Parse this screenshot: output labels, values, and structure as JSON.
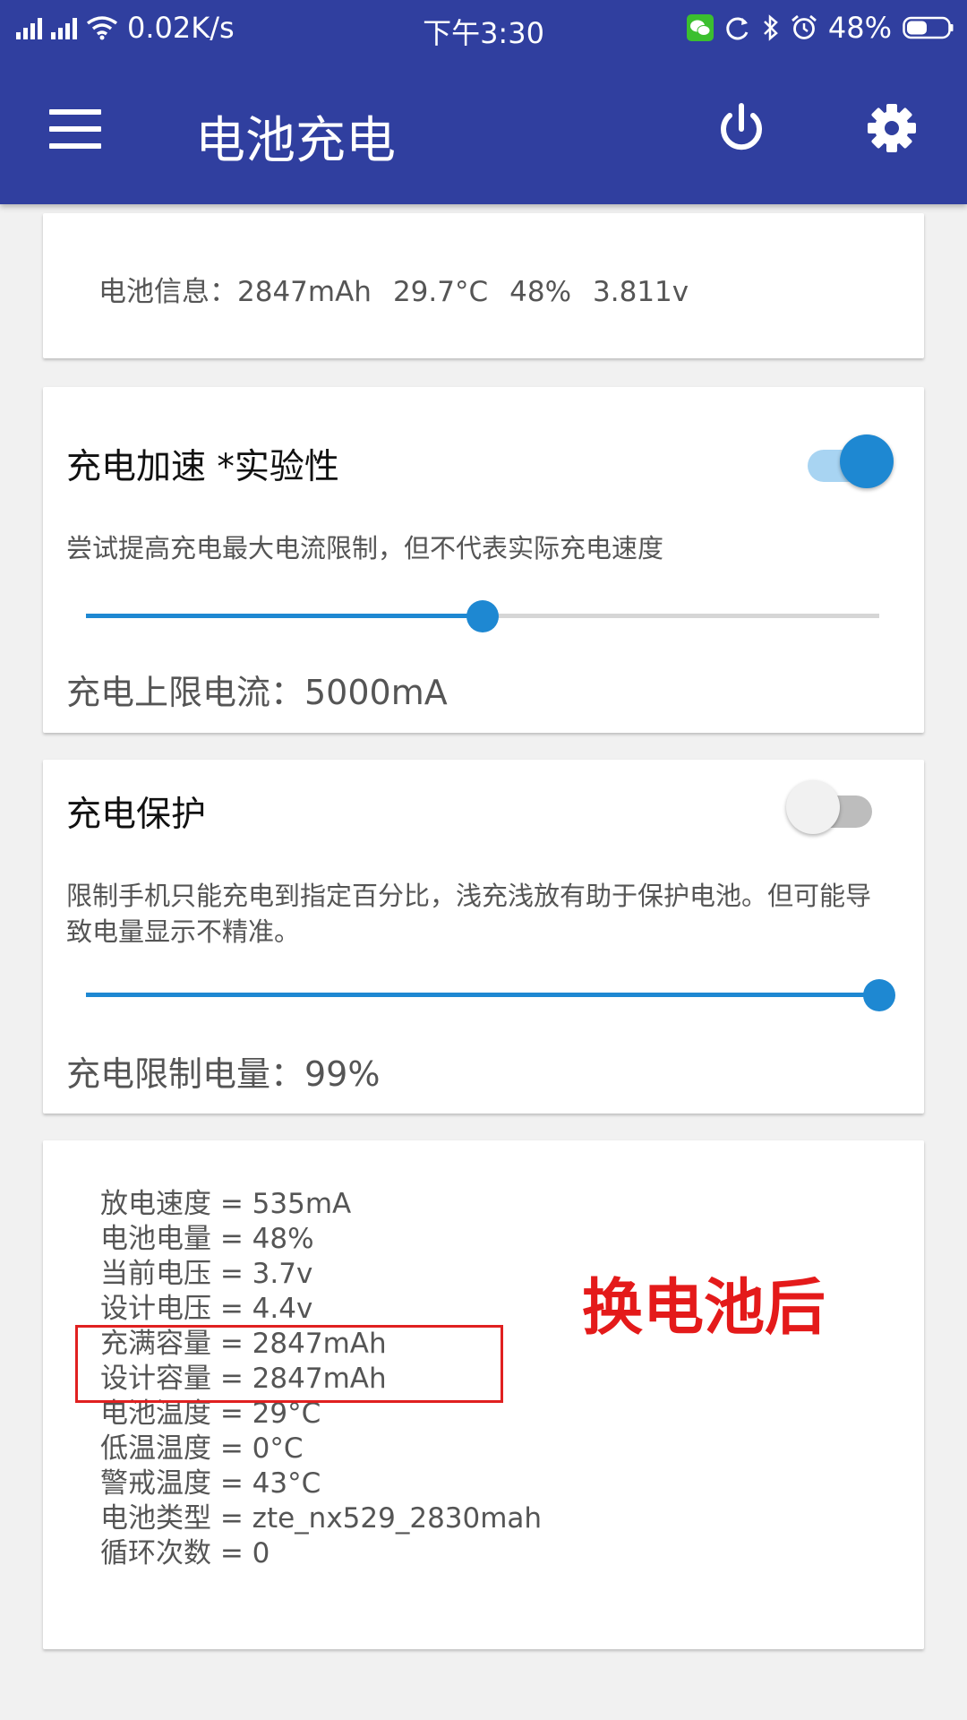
{
  "status_bar": {
    "net_speed": "0.02K/s",
    "time": "下午3:30",
    "battery": "48%",
    "icons": [
      "signal-icon",
      "signal-icon",
      "wifi-icon",
      "wechat-icon",
      "sync-icon",
      "bluetooth-icon",
      "alarm-icon",
      "battery-icon"
    ]
  },
  "toolbar": {
    "title": "电池充电",
    "menu_icon": "menu-icon",
    "power_icon": "power-icon",
    "settings_icon": "gear-icon"
  },
  "battery_info": {
    "label": "电池信息：",
    "capacity": "2847mAh",
    "temp": "29.7°C",
    "level": "48%",
    "voltage": "3.811v"
  },
  "boost": {
    "title": "充电加速 *实验性",
    "enabled": true,
    "desc": "尝试提高充电最大电流限制，但不代表实际充电速度",
    "slider_fraction": 0.5,
    "footer": "充电上限电流：5000mA"
  },
  "protect": {
    "title": "充电保护",
    "enabled": false,
    "desc": "限制手机只能充电到指定百分比，浅充浅放有助于保护电池。但可能导致电量显示不精准。",
    "slider_fraction": 1.0,
    "footer": "充电限制电量：99%"
  },
  "stats": [
    "放电速度 = 535mA",
    "电池电量 = 48%",
    "当前电压 = 3.7v",
    "设计电压 = 4.4v",
    "充满容量 = 2847mAh",
    "设计容量 = 2847mAh",
    "电池温度 = 29°C",
    "低温温度 = 0°C",
    "警戒温度 = 43°C",
    "电池类型 = zte_nx529_2830mah",
    "循环次数 = 0"
  ],
  "annotation": {
    "text": "换电池后",
    "color": "#e41a1a"
  },
  "colors": {
    "appbar": "#303f9f",
    "accent": "#1e88d2",
    "switch_on_track": "#a8d4f2",
    "switch_off_track": "#bdbdbd"
  }
}
